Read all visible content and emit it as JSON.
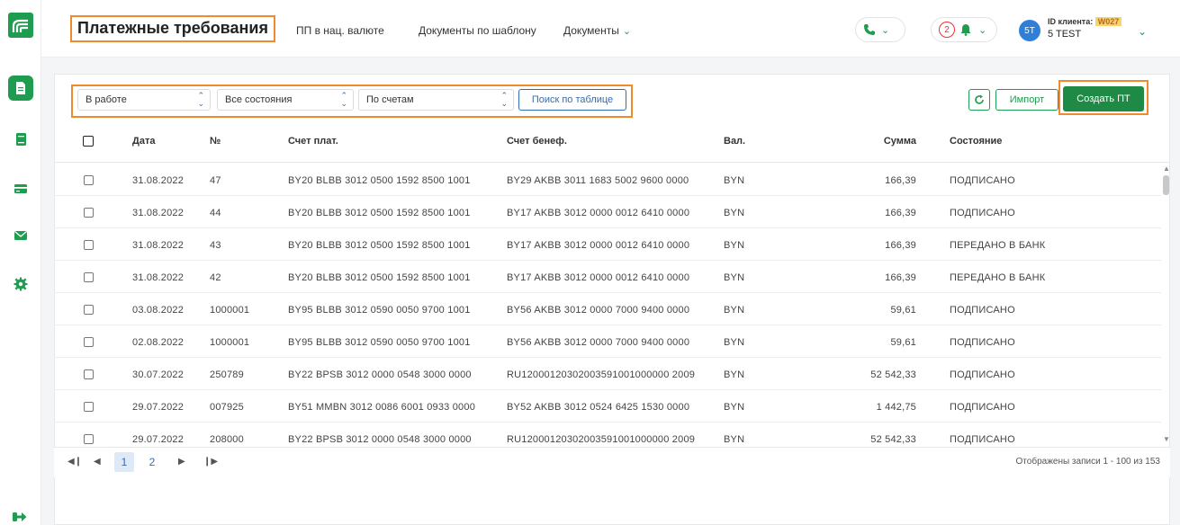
{
  "colors": {
    "accent": "#1e9c50",
    "highlight": "#f08a2b",
    "link": "#2f6db5"
  },
  "header": {
    "title": "Платежные требования",
    "nav": [
      {
        "label": "ПП в нац. валюте"
      },
      {
        "label": "Документы по шаблону"
      },
      {
        "label": "Документы"
      }
    ],
    "notifications_count": "2",
    "user": {
      "avatar": "5T",
      "client_id_label": "ID клиента:",
      "client_id": "W027",
      "name": "5 TEST"
    }
  },
  "sidebar": {
    "icons": [
      "documents-icon",
      "book-icon",
      "card-icon",
      "mail-icon",
      "settings-icon",
      "logout-icon"
    ]
  },
  "filters": {
    "status": "В работе",
    "state": "Все состояния",
    "grouping": "По счетам",
    "search_label": "Поиск по таблице"
  },
  "actions": {
    "import_label": "Импорт",
    "create_label": "Создать ПТ"
  },
  "table": {
    "columns": [
      "Дата",
      "№",
      "Счет плат.",
      "Счет бенеф.",
      "Вал.",
      "Сумма",
      "Состояние"
    ],
    "rows": [
      [
        "31.08.2022",
        "47",
        "BY20 BLBB 3012 0500 1592 8500 1001",
        "BY29 AKBB 3011 1683 5002 9600 0000",
        "BYN",
        "166,39",
        "ПОДПИСАНО"
      ],
      [
        "31.08.2022",
        "44",
        "BY20 BLBB 3012 0500 1592 8500 1001",
        "BY17 AKBB 3012 0000 0012 6410 0000",
        "BYN",
        "166,39",
        "ПОДПИСАНО"
      ],
      [
        "31.08.2022",
        "43",
        "BY20 BLBB 3012 0500 1592 8500 1001",
        "BY17 AKBB 3012 0000 0012 6410 0000",
        "BYN",
        "166,39",
        "ПЕРЕДАНО В БАНК"
      ],
      [
        "31.08.2022",
        "42",
        "BY20 BLBB 3012 0500 1592 8500 1001",
        "BY17 AKBB 3012 0000 0012 6410 0000",
        "BYN",
        "166,39",
        "ПЕРЕДАНО В БАНК"
      ],
      [
        "03.08.2022",
        "1000001",
        "BY95 BLBB 3012 0590 0050 9700 1001",
        "BY56 AKBB 3012 0000 7000 9400 0000",
        "BYN",
        "59,61",
        "ПОДПИСАНО"
      ],
      [
        "02.08.2022",
        "1000001",
        "BY95 BLBB 3012 0590 0050 9700 1001",
        "BY56 AKBB 3012 0000 7000 9400 0000",
        "BYN",
        "59,61",
        "ПОДПИСАНО"
      ],
      [
        "30.07.2022",
        "250789",
        "BY22 BPSB 3012 0000 0548 3000 0000",
        "RU12000120302003591001000000 2009",
        "BYN",
        "52 542,33",
        "ПОДПИСАНО"
      ],
      [
        "29.07.2022",
        "007925",
        "BY51 MMBN 3012 0086 6001 0933 0000",
        "BY52 AKBB 3012 0524 6425 1530 0000",
        "BYN",
        "1 442,75",
        "ПОДПИСАНО"
      ],
      [
        "29.07.2022",
        "208000",
        "BY22 BPSB 3012 0000 0548 3000 0000",
        "RU12000120302003591001000000 2009",
        "BYN",
        "52 542,33",
        "ПОДПИСАНО"
      ]
    ]
  },
  "pagination": {
    "pages": [
      "1",
      "2"
    ],
    "info": "Отображены записи 1 - 100 из 153"
  }
}
